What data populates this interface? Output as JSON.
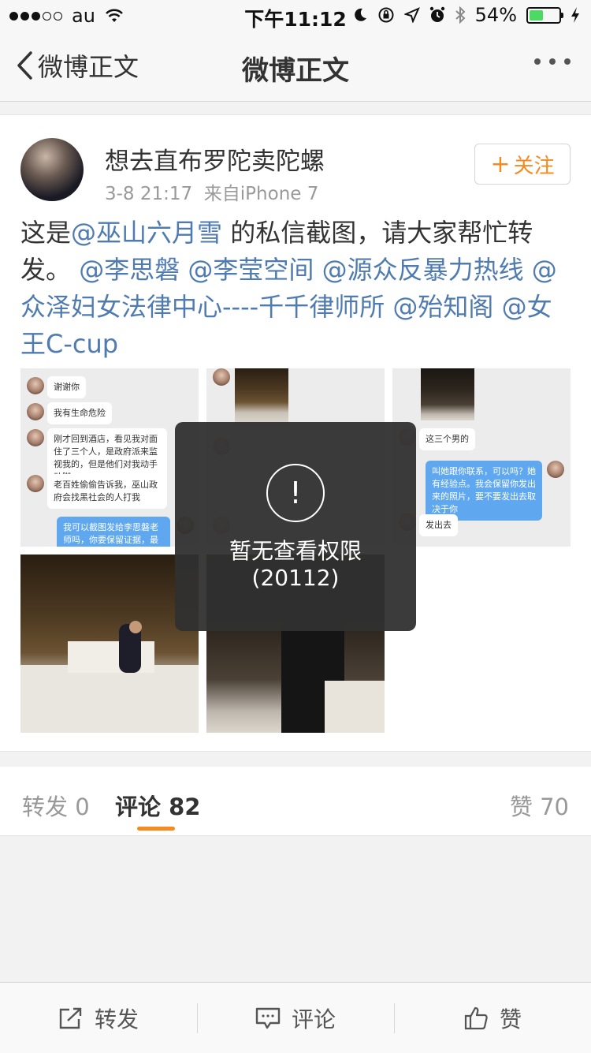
{
  "status_bar": {
    "carrier": "au",
    "time": "下午11:12",
    "battery_percent": "54%",
    "battery_level": 0.54,
    "icons": [
      "signal-dots",
      "wifi-icon",
      "moon-icon",
      "rotation-lock-icon",
      "location-icon",
      "alarm-icon",
      "bluetooth-icon",
      "battery-icon",
      "charging-icon"
    ]
  },
  "nav": {
    "back_label": "微博正文",
    "title": "微博正文"
  },
  "post": {
    "username": "想去直布罗陀卖陀螺",
    "date": "3-8 21:17",
    "source": "来自iPhone 7",
    "follow_label": "关注",
    "follow_plus": "+",
    "text_segments": [
      {
        "text": "这是",
        "mention": false
      },
      {
        "text": "@巫山六月雪",
        "mention": true
      },
      {
        "text": " 的私信截图，请大家帮忙转发。 ",
        "mention": false
      },
      {
        "text": "@李思磐",
        "mention": true
      },
      {
        "text": " ",
        "mention": false
      },
      {
        "text": "@李莹空间",
        "mention": true
      },
      {
        "text": " ",
        "mention": false
      },
      {
        "text": "@源众反暴力热线",
        "mention": true
      },
      {
        "text": " ",
        "mention": false
      },
      {
        "text": "@众泽妇女法律中心----千千律师所",
        "mention": true
      },
      {
        "text": " ",
        "mention": false
      },
      {
        "text": "@殆知阁",
        "mention": true
      },
      {
        "text": " ",
        "mention": false
      },
      {
        "text": "@女王C-cup",
        "mention": true
      }
    ],
    "photo1_bubbles": [
      "谢谢你",
      "我有生命危险",
      "刚才回到酒店，看见我对面住了三个人，是政府派来监视我的，但是他们对我动手动脚",
      "老百姓偷偷告诉我，巫山政府会找黑社会的人打我",
      "我可以截图发给李思磐老师吗，你要保留证据，最好有录像或者照片，人身安全最重要"
    ],
    "photo3_bubbles": [
      "这三个男的",
      "叫她跟你联系，可以吗？她有经验点。我会保留你发出来的照片，要不要发出去取决于你",
      "发出去"
    ]
  },
  "toast": {
    "icon": "!",
    "message": "暂无查看权限",
    "code": "(20112)"
  },
  "tabs": {
    "repost": "转发 0",
    "comment": "评论 82",
    "like": "赞 70"
  },
  "toolbar": {
    "repost": "转发",
    "comment": "评论",
    "like": "赞"
  }
}
